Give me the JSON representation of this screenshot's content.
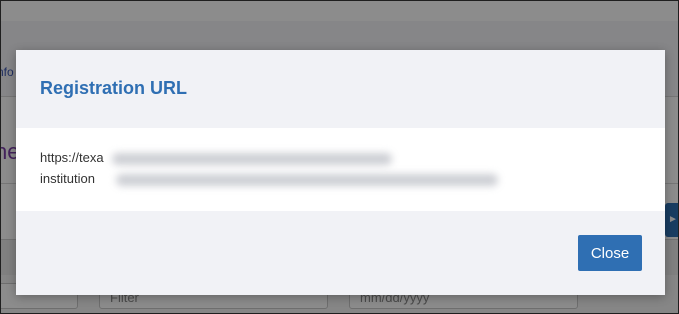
{
  "background": {
    "info_fragment": "nfo",
    "heading_fragment": "he",
    "filters": {
      "first_placeholder": "",
      "filter_placeholder": "Filter",
      "date_placeholder": "mm/dd/yyyy"
    }
  },
  "modal": {
    "title": "Registration URL",
    "url_line_1": "https://texa",
    "url_line_2": "institution",
    "close_label": "Close"
  },
  "colors": {
    "accent": "#2f6fb3",
    "modal_background": "#f1f2f6"
  }
}
